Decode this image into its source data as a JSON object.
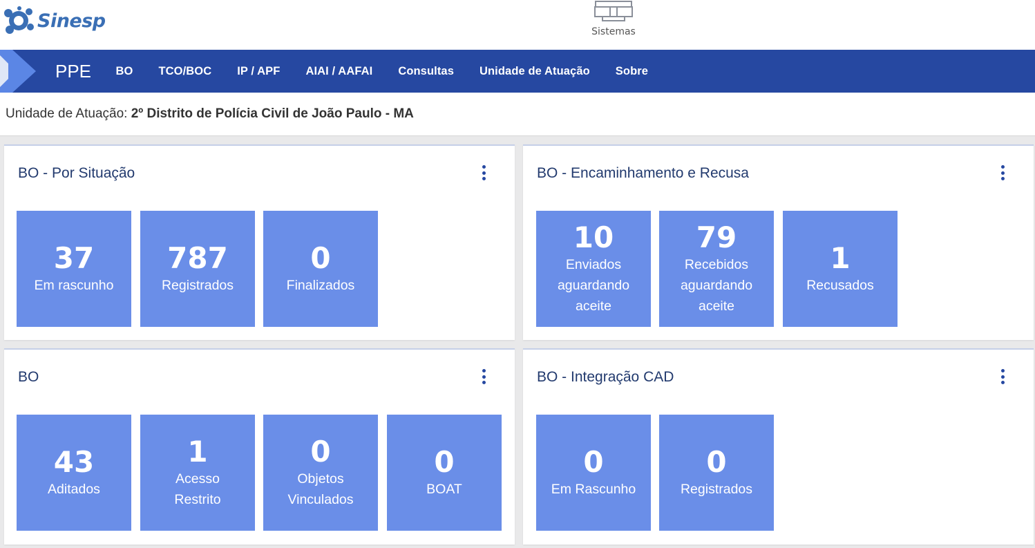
{
  "header": {
    "logo_text": "Sinesp",
    "systems_label": "Sistemas"
  },
  "navbar": {
    "brand": "PPE",
    "items": [
      "BO",
      "TCO/BOC",
      "IP / APF",
      "AIAI / AAFAI",
      "Consultas",
      "Unidade de Atuação",
      "Sobre"
    ],
    "background_color": "#2648a1"
  },
  "unit": {
    "label": "Unidade de Atuação:",
    "value": "2º Distrito de Polícia Civil de João Paulo - MA"
  },
  "cards": [
    {
      "title": "BO - Por Situação",
      "tiles": [
        {
          "value": "37",
          "label": "Em rascunho"
        },
        {
          "value": "787",
          "label": "Registrados"
        },
        {
          "value": "0",
          "label": "Finalizados"
        }
      ]
    },
    {
      "title": "BO - Encaminhamento e Recusa",
      "tiles": [
        {
          "value": "10",
          "label": "Enviados aguardando aceite"
        },
        {
          "value": "79",
          "label": "Recebidos aguardando aceite"
        },
        {
          "value": "1",
          "label": "Recusados"
        }
      ]
    },
    {
      "title": "BO",
      "tiles": [
        {
          "value": "43",
          "label": "Aditados"
        },
        {
          "value": "1",
          "label": "Acesso Restrito"
        },
        {
          "value": "0",
          "label": "Objetos Vinculados"
        },
        {
          "value": "0",
          "label": "BOAT"
        }
      ]
    },
    {
      "title": "BO - Integração CAD",
      "tiles": [
        {
          "value": "0",
          "label": "Em Rascunho"
        },
        {
          "value": "0",
          "label": "Registrados"
        }
      ]
    }
  ],
  "colors": {
    "tile": "#6a8ee8",
    "accent": "#2648a1",
    "page_background": "#e9e9ea"
  }
}
